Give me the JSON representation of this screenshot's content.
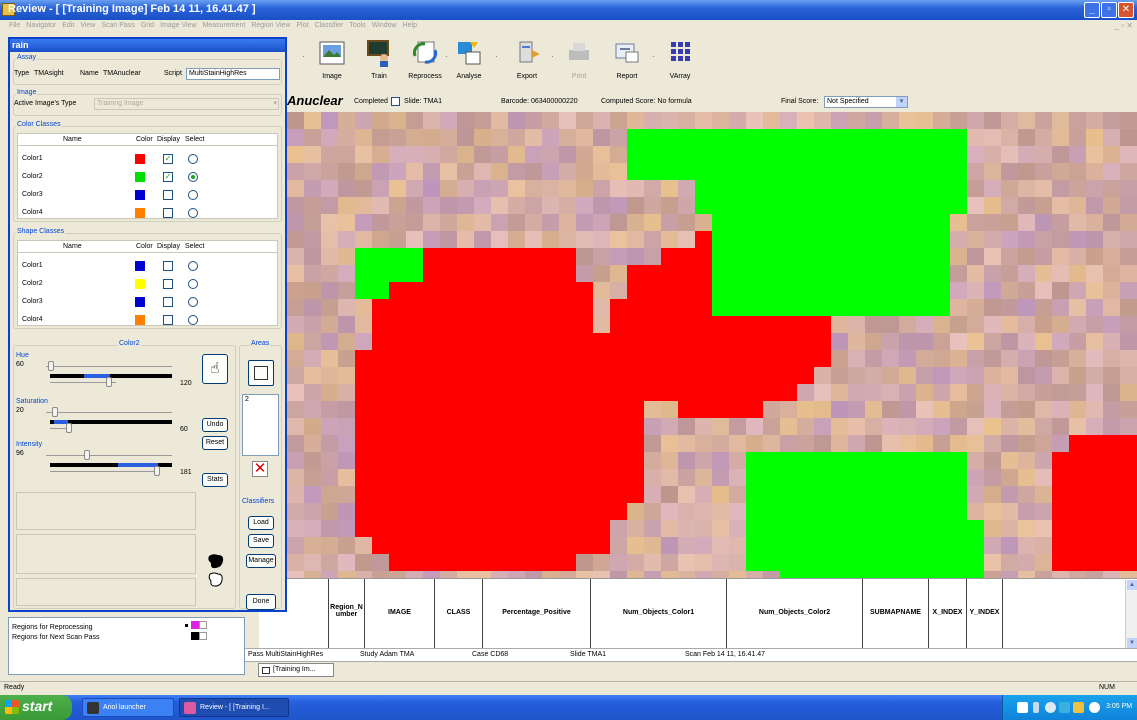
{
  "window": {
    "title": "Review - [ [Training Image] Feb 14 11, 16.41.47 ]"
  },
  "menu": [
    "File",
    "Navigator",
    "Edit",
    "View",
    "Scan Pass",
    "Grid",
    "Image View",
    "Measurement",
    "Region View",
    "Plot",
    "Classifier",
    "Tools",
    "Window",
    "Help"
  ],
  "toolbar": {
    "items": [
      {
        "label": "Image",
        "icon": "image-icon"
      },
      {
        "label": "Train",
        "icon": "train-icon"
      },
      {
        "label": "Reprocess",
        "icon": "reprocess-icon"
      },
      {
        "label": "Analyse",
        "icon": "analyse-icon"
      },
      {
        "label": "Export",
        "icon": "export-icon"
      },
      {
        "label": "Print",
        "icon": "print-icon"
      },
      {
        "label": "Report",
        "icon": "report-icon"
      },
      {
        "label": "VArray",
        "icon": "varray-icon"
      }
    ]
  },
  "infobar": {
    "assay_name": "Anuclear",
    "completed_label": "Completed",
    "slide": "Slide: TMA1",
    "barcode": "Barcode: 063400000220",
    "computed_score": "Computed Score: No formula",
    "final_score_label": "Final Score:",
    "final_score_value": "Not Specified"
  },
  "train": {
    "title": "rain",
    "assay": {
      "group": "Assay",
      "type_label": "Type",
      "type_value": "TMAsight",
      "name_label": "Name",
      "name_value": "TMAnuclear",
      "script_label": "Script",
      "script_value": "MultiStainHighRes"
    },
    "image": {
      "group": "Image",
      "active_label": "Active Image's Type",
      "active_value": "Training Image"
    },
    "color_classes": {
      "group": "Color Classes",
      "headers": {
        "name": "Name",
        "color": "Color",
        "display": "Display",
        "select": "Select"
      },
      "rows": [
        {
          "name": "Color1",
          "color": "#ff0000",
          "display": true,
          "selected": false
        },
        {
          "name": "Color2",
          "color": "#00e000",
          "display": true,
          "selected": true
        },
        {
          "name": "Color3",
          "color": "#0000d0",
          "display": false,
          "selected": false
        },
        {
          "name": "Color4",
          "color": "#ff8000",
          "display": false,
          "selected": false
        }
      ]
    },
    "shape_classes": {
      "group": "Shape Classes",
      "headers": {
        "name": "Name",
        "color": "Color",
        "display": "Display",
        "select": "Select"
      },
      "rows": [
        {
          "name": "Color1",
          "color": "#0000d0",
          "display": false,
          "selected": false
        },
        {
          "name": "Color2",
          "color": "#ffff00",
          "display": false,
          "selected": false
        },
        {
          "name": "Color3",
          "color": "#0000d0",
          "display": false,
          "selected": false
        },
        {
          "name": "Color4",
          "color": "#ff8000",
          "display": false,
          "selected": false
        }
      ]
    },
    "color_adjust": {
      "group": "Color2",
      "hue_label": "Hue",
      "hue_low": "60",
      "hue_high": "120",
      "saturation_label": "Saturation",
      "saturation_low": "20",
      "saturation_high": "60",
      "intensity_label": "Intensity",
      "intensity_low": "96",
      "intensity_high": "181"
    },
    "buttons": {
      "undo": "Undo",
      "reset": "Reset",
      "stats": "Stats",
      "load": "Load",
      "save": "Save",
      "manage": "Manage",
      "done": "Done"
    },
    "areas": {
      "group": "Areas",
      "list_value": "2"
    },
    "classifiers": {
      "group": "Classifiers"
    }
  },
  "table": {
    "headers": [
      "Region_N umber",
      "IMAGE",
      "CLASS",
      "Percentage_Positive",
      "Num_Objects_Color1",
      "Num_Objects_Color2",
      "SUBMAPNAME",
      "X_INDEX",
      "Y_INDEX"
    ]
  },
  "scanrow": {
    "pass": "Pass MultiStainHighRes",
    "study": "Study Adam TMA",
    "case": "Case CD68",
    "slide": "Slide TMA1",
    "scan": "Scan Feb 14 11, 16.41.47"
  },
  "doc_tab": "[Training Im...",
  "leftlist": {
    "items": [
      "Regions for Reprocessing",
      "Regions for Next Scan Pass"
    ]
  },
  "status": {
    "left": "Ready",
    "right": "NUM"
  },
  "taskbar": {
    "start": "start",
    "buttons": [
      "Ariol launcher",
      "Review - [ [Training I..."
    ],
    "clock": "3:05 PM"
  },
  "colors": {
    "red_class": "#ff0000",
    "green_class": "#00ff00",
    "xp_blue": "#245edb"
  }
}
